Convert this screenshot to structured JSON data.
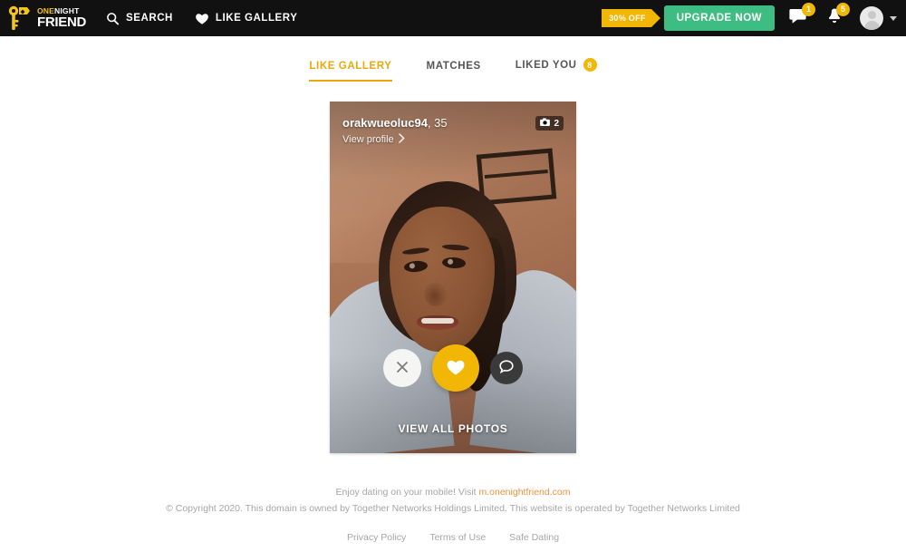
{
  "header": {
    "logo": {
      "line1_part1": "ONE",
      "line1_part2": "NIGHT",
      "line2": "FRIEND",
      "icon": "keys-icon"
    },
    "nav": [
      {
        "label": "SEARCH",
        "icon": "search-icon"
      },
      {
        "label": "LIKE GALLERY",
        "icon": "heart-icon"
      }
    ],
    "promo_tag": "30% OFF",
    "upgrade_label": "UPGRADE NOW",
    "messages_badge": "1",
    "notifications_badge": "5",
    "avatar_alt": "user-avatar"
  },
  "tabs": [
    {
      "label": "LIKE GALLERY",
      "active": true,
      "badge": ""
    },
    {
      "label": "MATCHES",
      "active": false,
      "badge": ""
    },
    {
      "label": "LIKED YOU",
      "active": false,
      "badge": "8"
    }
  ],
  "card": {
    "username": "orakwueoluc94",
    "age": ", 35",
    "view_profile": "View profile",
    "photo_count": "2",
    "view_all_photos": "VIEW ALL PHOTOS",
    "actions": {
      "skip": "skip-icon",
      "like": "heart-icon",
      "chat": "chat-icon"
    }
  },
  "footer": {
    "mobile_prefix": "Enjoy dating on your mobile! Visit ",
    "mobile_link": "m.onenightfriend.com",
    "copyright": "© Copyright 2020. This domain is owned by Together Networks Holdings Limited. This website is operated by Together Networks Limited",
    "links": [
      "Privacy Policy",
      "Terms of Use",
      "Safe Dating"
    ]
  },
  "colors": {
    "accent": "#f2b705",
    "active_tab": "#e7a90e",
    "upgrade_green": "#3ebd83",
    "header_bg": "#111111",
    "link_orange": "#e8953d"
  }
}
